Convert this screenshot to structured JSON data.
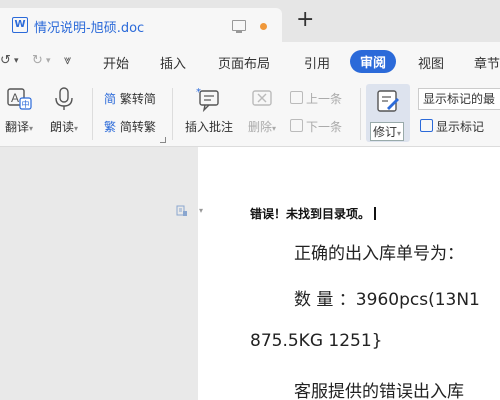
{
  "tabbar": {
    "doc_title": "情况说明-旭硕.doc",
    "doc_icon_letter": "W",
    "new_tab": "+"
  },
  "quick_access": {
    "undo": "↺",
    "undo_menu": "▾",
    "redo": "↻",
    "redo_menu": "▾",
    "more": "⩔"
  },
  "ribbon_tabs": [
    {
      "label": "开始"
    },
    {
      "label": "插入"
    },
    {
      "label": "页面布局"
    },
    {
      "label": "引用"
    },
    {
      "label": "审阅",
      "active": true
    },
    {
      "label": "视图"
    },
    {
      "label": "章节"
    }
  ],
  "toolbar": {
    "translate": "翻译",
    "read_aloud": "朗读",
    "trad_to_simp": "繁转简",
    "simp_to_trad": "简转繁",
    "trad_char": "简",
    "simp_char": "繁",
    "insert_comment": "插入批注",
    "delete": "删除",
    "prev_item": "上一条",
    "next_item": "下一条",
    "revise": "修订",
    "markup_display_mode": "显示标记的最",
    "show_markup": "显示标记"
  },
  "document": {
    "error_line": "错误！未找到目录项。",
    "line1": "正确的出入库单号为：",
    "line2": "数 量 ：3960pcs(13N1",
    "line3": "875.5KG    1251}",
    "line4": "客服提供的错误出入库"
  },
  "colors": {
    "accent": "#2b6ad9",
    "unsaved_dot": "#f0983a"
  }
}
